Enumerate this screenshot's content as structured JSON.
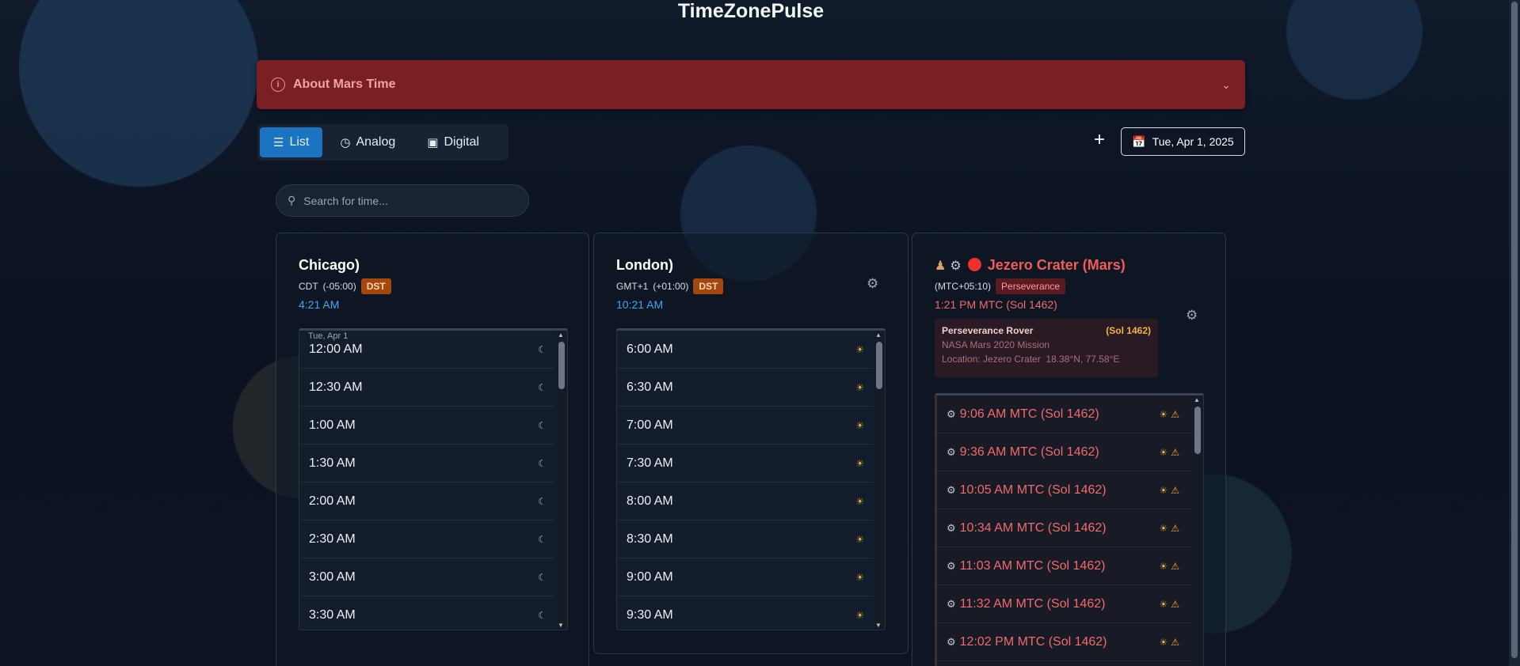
{
  "app": {
    "title": "TimeZonePulse"
  },
  "about": {
    "label": "About Mars Time"
  },
  "views": [
    {
      "label": "List",
      "icon": "list-icon",
      "active": true
    },
    {
      "label": "Analog",
      "icon": "clock-icon",
      "active": false
    },
    {
      "label": "Digital",
      "icon": "digital-icon",
      "active": false
    }
  ],
  "date_picker": {
    "label": "Tue, Apr 1, 2025"
  },
  "search": {
    "placeholder": "Search for time..."
  },
  "chicago": {
    "title": "Chicago)",
    "abbr": "CDT",
    "offset": "(-05:00)",
    "dst": "DST",
    "now": "4:21 AM",
    "day_label": "Tue, Apr 1",
    "times": [
      "12:00 AM",
      "12:30 AM",
      "1:00 AM",
      "1:30 AM",
      "2:00 AM",
      "2:30 AM",
      "3:00 AM",
      "3:30 AM"
    ]
  },
  "london": {
    "title": "London)",
    "abbr": "GMT+1",
    "offset": "(+01:00)",
    "dst": "DST",
    "now": "10:21 AM",
    "times": [
      "6:00 AM",
      "6:30 AM",
      "7:00 AM",
      "7:30 AM",
      "8:00 AM",
      "8:30 AM",
      "9:00 AM",
      "9:30 AM"
    ]
  },
  "mars": {
    "title": "Jezero Crater (Mars)",
    "offset": "(MTC+05:10)",
    "tag": "Perseverance",
    "now": "1:21 PM MTC (Sol 1462)",
    "rover": {
      "name": "Perseverance Rover",
      "sol": "(Sol 1462)",
      "mission": "NASA Mars 2020 Mission",
      "location": "Location: Jezero Crater",
      "coords": "18.38°N, 77.58°E"
    },
    "times": [
      "9:06 AM MTC (Sol 1462)",
      "9:36 AM MTC (Sol 1462)",
      "10:05 AM MTC (Sol 1462)",
      "10:34 AM MTC (Sol 1462)",
      "11:03 AM MTC (Sol 1462)",
      "11:32 AM MTC (Sol 1462)",
      "12:02 PM MTC (Sol 1462)"
    ]
  },
  "colors": {
    "accent": "#1a74c2",
    "mars": "#f05b5b",
    "dst": "#a4470f",
    "now": "#3fa7f5"
  }
}
